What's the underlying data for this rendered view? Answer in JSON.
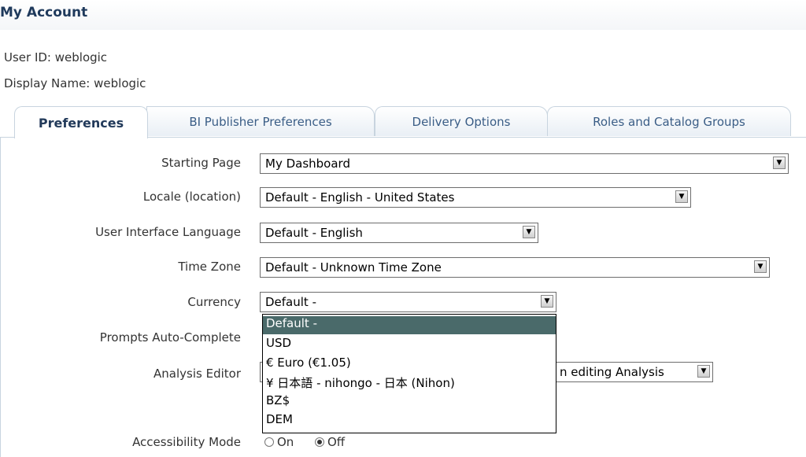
{
  "page_title": "My Account",
  "user": {
    "id_text": "User ID: weblogic",
    "display_name_text": "Display Name: weblogic"
  },
  "tabs": [
    {
      "label": "Preferences",
      "active": true
    },
    {
      "label": "BI Publisher Preferences",
      "active": false
    },
    {
      "label": "Delivery Options",
      "active": false
    },
    {
      "label": "Roles and Catalog Groups",
      "active": false
    }
  ],
  "form": {
    "starting_page": {
      "label": "Starting Page",
      "value": "My Dashboard"
    },
    "locale": {
      "label": "Locale (location)",
      "value": "Default - English - United States"
    },
    "ui_language": {
      "label": "User Interface Language",
      "value": "Default - English"
    },
    "time_zone": {
      "label": "Time Zone",
      "value": "Default - Unknown Time Zone"
    },
    "currency": {
      "label": "Currency",
      "value": "Default -",
      "options": [
        "Default -",
        "USD",
        "€ Euro (€1.05)",
        "¥ 日本語  - nihongo - 日本  (Nihon)",
        "BZ$",
        "DEM"
      ],
      "selected_index": 0
    },
    "prompts_auto_complete": {
      "label": "Prompts Auto-Complete"
    },
    "analysis_editor": {
      "label": "Analysis Editor",
      "value_visible": "n editing Analysis"
    },
    "accessibility_mode": {
      "label": "Accessibility Mode",
      "on_label": "On",
      "off_label": "Off",
      "selected": "Off"
    }
  },
  "colors": {
    "title": "#1f3a5c",
    "tab_text": "#3a5d86",
    "selected_option_bg": "#4a6a6a"
  },
  "icons": {
    "dropdown_button": "chevron-down-icon"
  }
}
